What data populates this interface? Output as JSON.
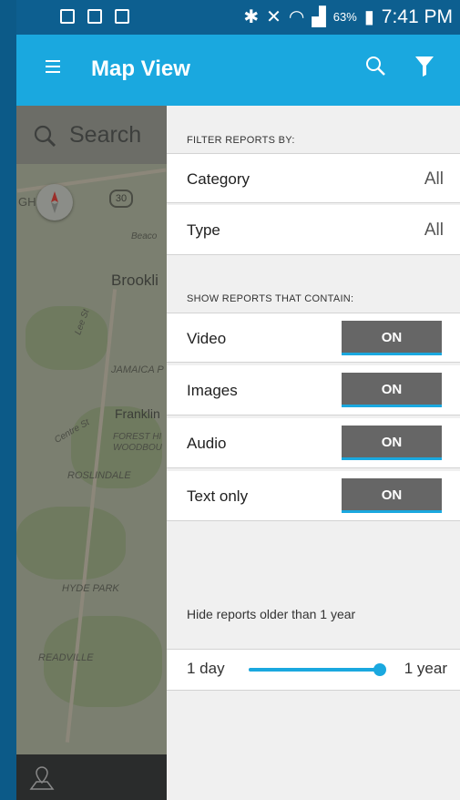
{
  "status_bar": {
    "battery_percent": "63%",
    "time": "7:41 PM"
  },
  "app_bar": {
    "title": "Map View"
  },
  "map": {
    "search_placeholder": "Search",
    "route_number": "30",
    "labels": {
      "brookline": "Brookli",
      "beacon": "Beaco",
      "jamaica": "JAMAICA P",
      "franklin": "Franklin",
      "forest_hills": "FOREST HI",
      "woodbourne": "WOODBOU",
      "roslindale": "ROSLINDALE",
      "hyde_park": "HYDE PARK",
      "readville": "READVILLE",
      "centre_st": "Centre St",
      "lee_st": "Lee St",
      "edge": "GH"
    }
  },
  "filter_panel": {
    "filter_header": "FILTER REPORTS BY:",
    "category": {
      "label": "Category",
      "value": "All"
    },
    "type": {
      "label": "Type",
      "value": "All"
    },
    "contain_header": "SHOW REPORTS THAT CONTAIN:",
    "toggles": [
      {
        "label": "Video",
        "state": "ON"
      },
      {
        "label": "Images",
        "state": "ON"
      },
      {
        "label": "Audio",
        "state": "ON"
      },
      {
        "label": "Text only",
        "state": "ON"
      }
    ],
    "hide_text": "Hide reports older than 1 year",
    "slider": {
      "min_label": "1 day",
      "max_label": "1 year",
      "value_fraction": 1.0
    }
  },
  "colors": {
    "accent": "#1aa8df",
    "status_bar": "#0d5f90",
    "toggle_bg": "#666666"
  }
}
